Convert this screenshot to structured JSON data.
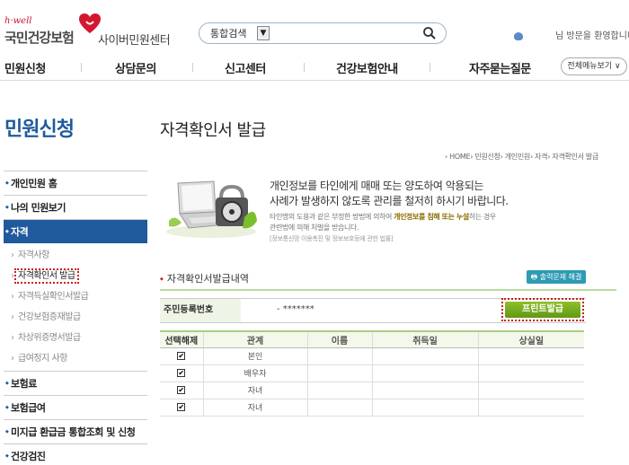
{
  "header": {
    "logo_hwell": "h·well",
    "logo_brand": "국민건강보험",
    "logo_sub": "사이버민원센터",
    "search_scope": "통합검색",
    "search_value": "",
    "welcome_text": "님 방문을 환영합니다."
  },
  "gnb": {
    "items": [
      "민원신청",
      "상담문의",
      "신고센터",
      "건강보험안내",
      "자주묻는질문"
    ],
    "all_menu_label": "전체메뉴보기 ∨"
  },
  "sidebar": {
    "title": "민원신청",
    "menu": [
      {
        "label": "개인민원 홈"
      },
      {
        "label": "나의 민원보기"
      },
      {
        "label": "자격"
      },
      {
        "label": "자격사항"
      },
      {
        "label": "자격확인서 발급"
      },
      {
        "label": "자격득실확인서발급"
      },
      {
        "label": "건강보험증재발급"
      },
      {
        "label": "차상위증명서발급"
      },
      {
        "label": "급여정지 사항"
      },
      {
        "label": "보험료"
      },
      {
        "label": "보험급여"
      },
      {
        "label": "미지급 환급금 통합조회 및 신청"
      },
      {
        "label": "건강검진"
      }
    ]
  },
  "main": {
    "page_title": "자격확인서 발급",
    "breadcrumb": "› HOME› 민원신청› 개인민원› 자격› 자격확인서 발급",
    "notice": {
      "line1": "개인정보를 타인에게 매매 또는 양도하여 악용되는",
      "line2": "사례가 발생하지 않도록 관리를 철저히 하시기 바랍니다.",
      "body1_pre": "타인명의 도용과 같은 부정한 방법에 의하여 ",
      "body1_hl": "개인정보를 침해 또는 누설",
      "body1_post": "하는 경우",
      "body2": "관련법에 의해 처벌을 받습니다.",
      "law": "[정보통신망 이용촉진 및 정보보호등에 관한 법률]"
    },
    "section_title": "자격확인서발급내역",
    "print_help_label": "출력문제 해결",
    "rrn_label": "주민등록번호",
    "rrn_value": "- *******",
    "print_button": "프린트발급",
    "table": {
      "headers": [
        "선택해제",
        "관계",
        "이름",
        "취득일",
        "상실일"
      ],
      "rows": [
        {
          "checked": "✔",
          "relation": "본인",
          "name": "",
          "acquired": "",
          "lost": ""
        },
        {
          "checked": "✔",
          "relation": "배우자",
          "name": "",
          "acquired": "",
          "lost": ""
        },
        {
          "checked": "✔",
          "relation": "자녀",
          "name": "",
          "acquired": "",
          "lost": ""
        },
        {
          "checked": "✔",
          "relation": "자녀",
          "name": "",
          "acquired": "",
          "lost": ""
        }
      ]
    }
  }
}
